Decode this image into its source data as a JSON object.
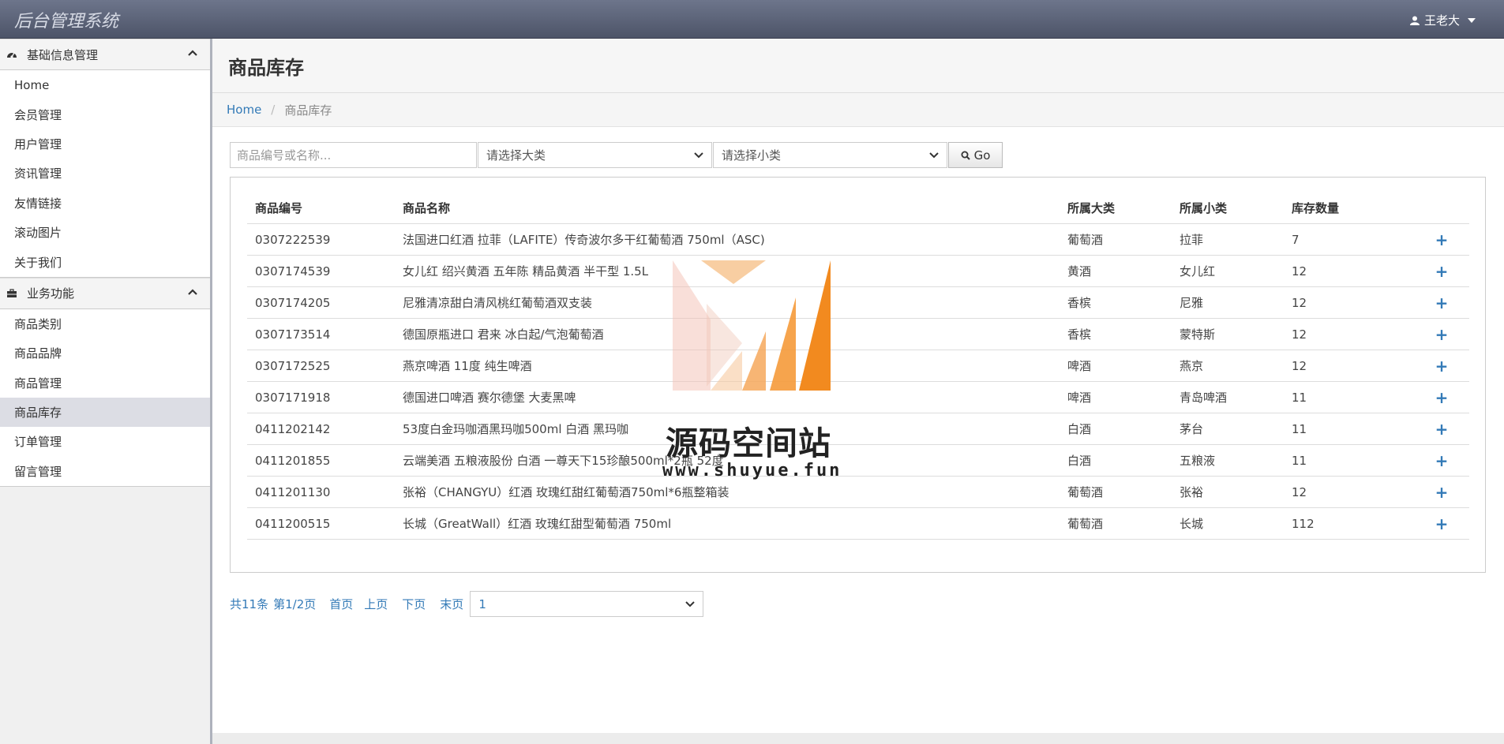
{
  "app": {
    "title": "后台管理系统",
    "user": "王老大"
  },
  "sidebar": {
    "sections": [
      {
        "title": "基础信息管理",
        "items": [
          "Home",
          "会员管理",
          "用户管理",
          "资讯管理",
          "友情链接",
          "滚动图片",
          "关于我们"
        ]
      },
      {
        "title": "业务功能",
        "items": [
          "商品类别",
          "商品品牌",
          "商品管理",
          "商品库存",
          "订单管理",
          "留言管理"
        ]
      }
    ],
    "active_item": "商品库存"
  },
  "page": {
    "title": "商品库存",
    "breadcrumb": [
      "Home",
      "商品库存"
    ]
  },
  "filters": {
    "search_placeholder": "商品编号或名称...",
    "category_select": "请选择大类",
    "subcategory_select": "请选择小类",
    "go_label": "Go"
  },
  "table": {
    "headers": [
      "商品编号",
      "商品名称",
      "所属大类",
      "所属小类",
      "库存数量"
    ],
    "rows": [
      [
        "0307222539",
        "法国进口红酒 拉菲（LAFITE）传奇波尔多干红葡萄酒 750ml（ASC)",
        "葡萄酒",
        "拉菲",
        "7"
      ],
      [
        "0307174539",
        "女儿红 绍兴黄酒 五年陈 精品黄酒 半干型 1.5L",
        "黄酒",
        "女儿红",
        "12"
      ],
      [
        "0307174205",
        "尼雅清凉甜白清风桃红葡萄酒双支装",
        "香槟",
        "尼雅",
        "12"
      ],
      [
        "0307173514",
        "德国原瓶进口 君来 冰白起/气泡葡萄酒",
        "香槟",
        "蒙特斯",
        "12"
      ],
      [
        "0307172525",
        "燕京啤酒 11度 纯生啤酒",
        "啤酒",
        "燕京",
        "12"
      ],
      [
        "0307171918",
        "德国进口啤酒 赛尔德堡 大麦黑啤",
        "啤酒",
        "青岛啤酒",
        "11"
      ],
      [
        "0411202142",
        "53度白金玛咖酒黑玛咖500ml 白酒 黑玛咖",
        "白酒",
        "茅台",
        "11"
      ],
      [
        "0411201855",
        "云端美酒 五粮液股份 白酒 一尊天下15珍酿500ml*2瓶 52度",
        "白酒",
        "五粮液",
        "11"
      ],
      [
        "0411201130",
        "张裕（CHANGYU）红酒 玫瑰红甜红葡萄酒750ml*6瓶整箱装",
        "葡萄酒",
        "张裕",
        "12"
      ],
      [
        "0411200515",
        "长城（GreatWall）红酒 玫瑰红甜型葡萄酒 750ml",
        "葡萄酒",
        "长城",
        "112"
      ]
    ],
    "action_label": "+"
  },
  "pager": {
    "total": "共11条",
    "page_info": "第1/2页",
    "first": "首页",
    "prev": "上页",
    "next": "下页",
    "last": "末页",
    "page_select": "1"
  },
  "watermark": {
    "text_cn": "源码空间站",
    "url": "www.shuyue.fun"
  },
  "colors": {
    "link": "#337ab7",
    "navbar": "#5a6175",
    "active_item": "#dcdde4",
    "watermark_orange": "#f28a1f"
  }
}
